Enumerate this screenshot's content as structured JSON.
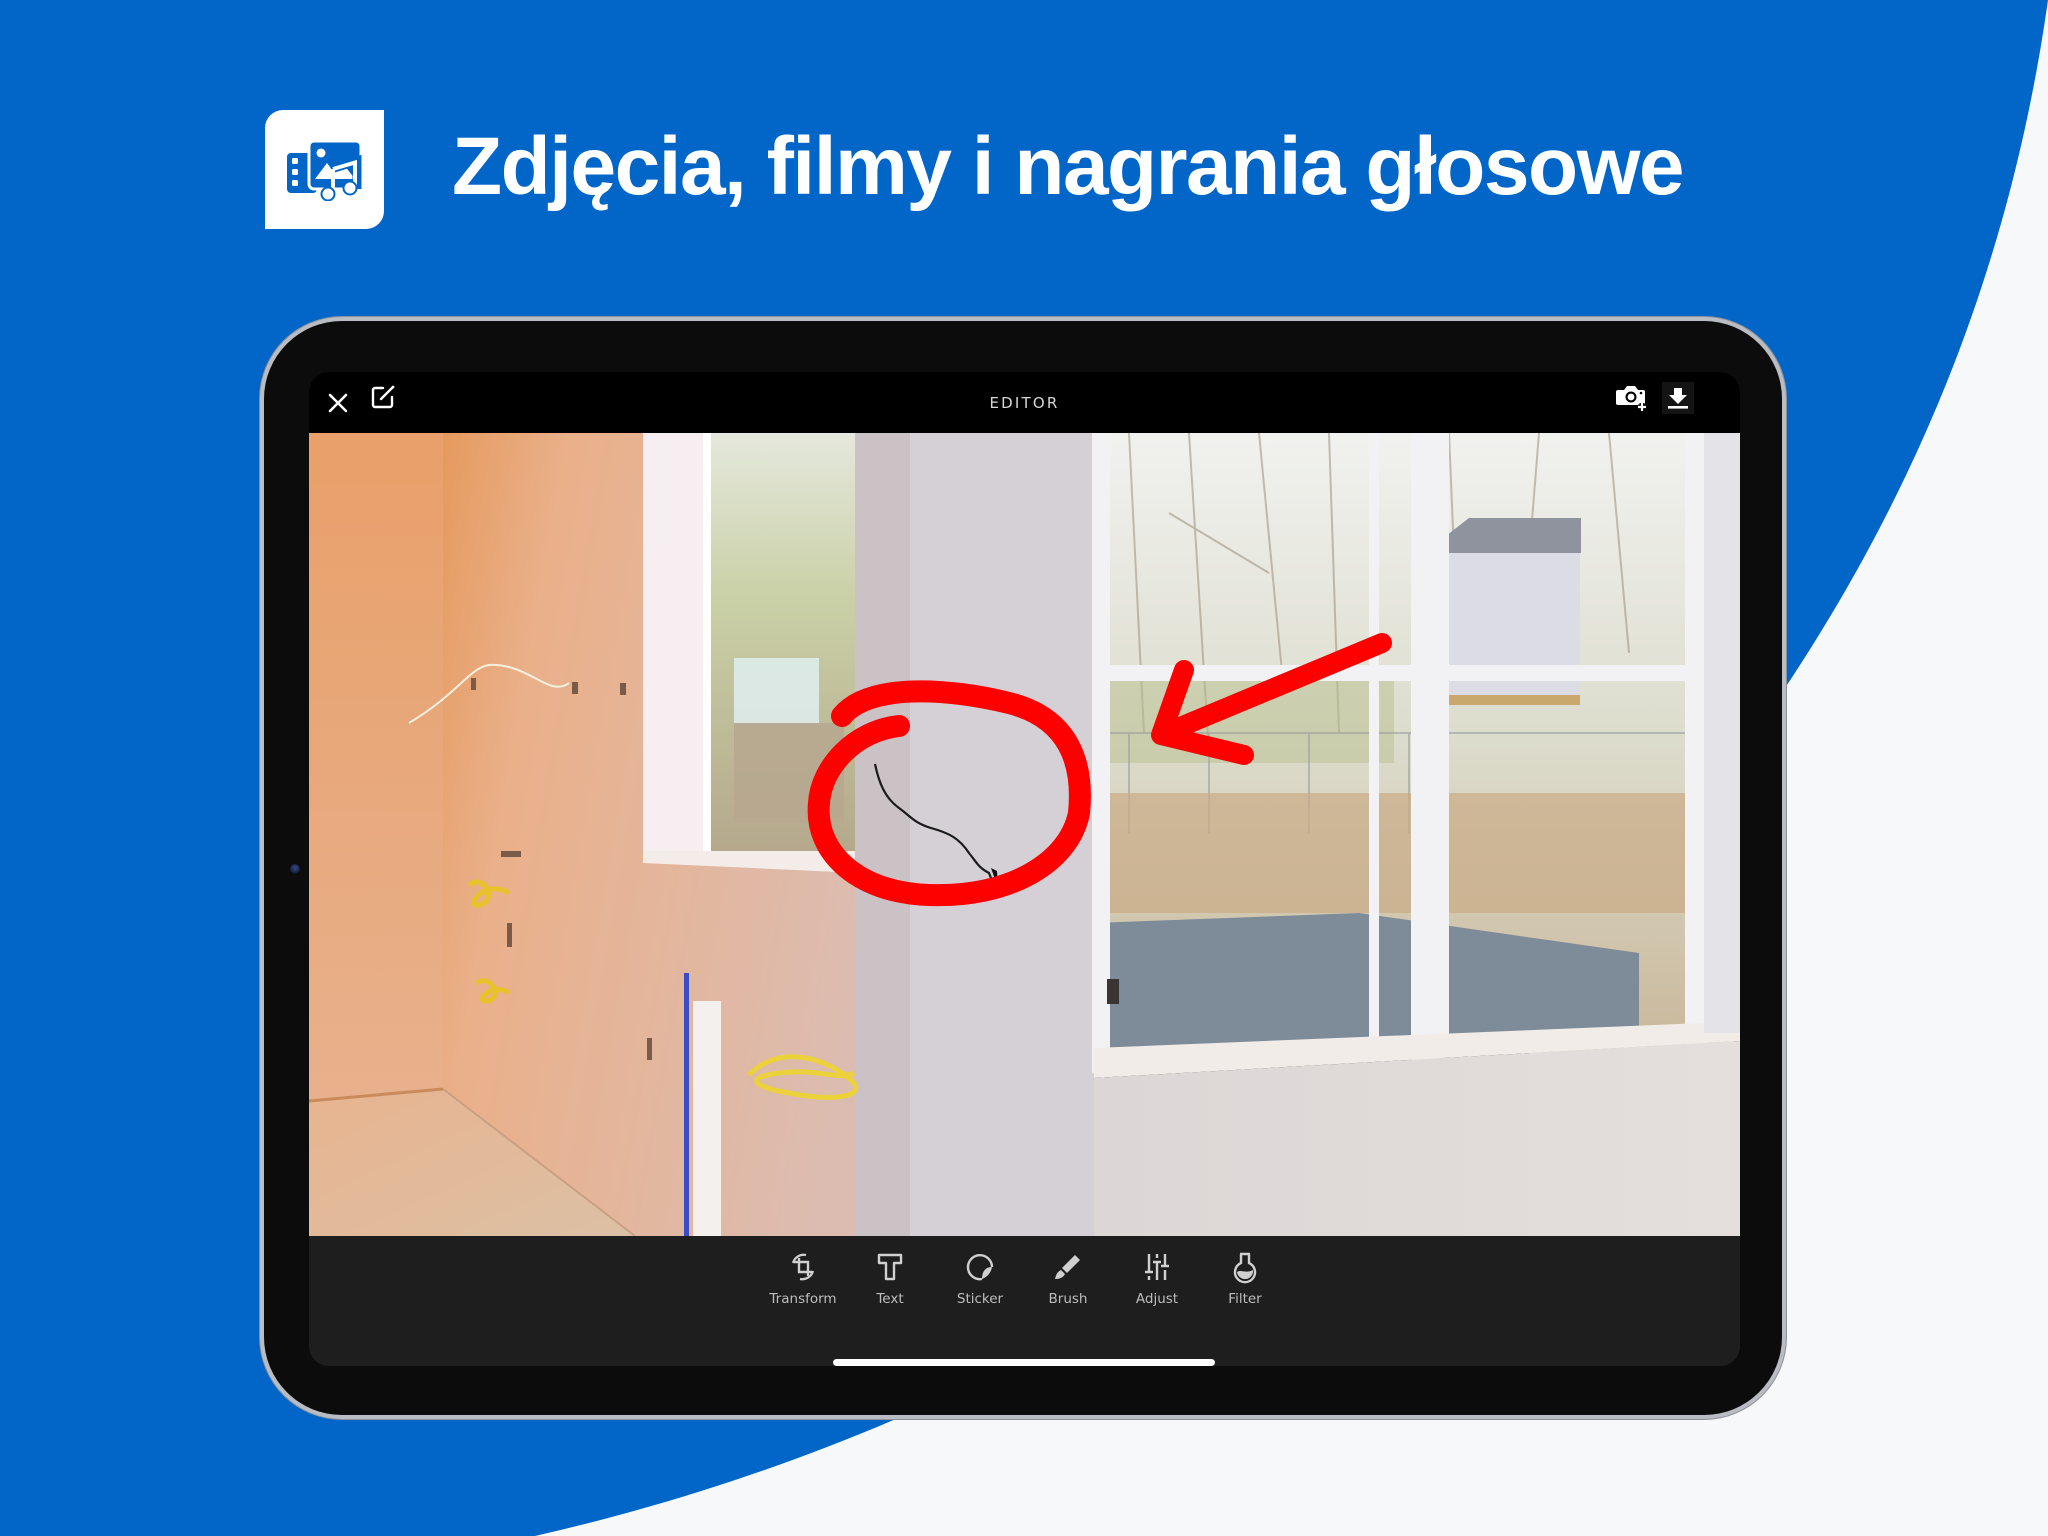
{
  "colors": {
    "brand_blue": "#0265c8",
    "page_background": "#f7f8f9",
    "annotation_red": "#ff0000"
  },
  "header": {
    "badge_icon": "media-gallery-icon",
    "headline": "Zdjęcia, filmy i nagrania głosowe"
  },
  "editor": {
    "title": "EDITOR",
    "top_left_icons": [
      {
        "name": "close-icon",
        "symbol": "✕"
      },
      {
        "name": "edit-square-icon",
        "symbol": "✎"
      }
    ],
    "top_right_icons": [
      {
        "name": "add-photo-camera-icon",
        "symbol": "📷+"
      },
      {
        "name": "download-icon",
        "symbol": "⬇"
      }
    ],
    "photo": {
      "description": "Interior room under renovation with drywall, windows and a marked crack",
      "annotations": [
        "red circle around crack",
        "red arrow pointing at circle"
      ]
    },
    "tools": [
      {
        "label": "Transform",
        "icon": "crop-rotate-icon"
      },
      {
        "label": "Text",
        "icon": "text-icon"
      },
      {
        "label": "Sticker",
        "icon": "sticker-icon"
      },
      {
        "label": "Brush",
        "icon": "brush-icon"
      },
      {
        "label": "Adjust",
        "icon": "sliders-icon"
      },
      {
        "label": "Filter",
        "icon": "flask-icon"
      }
    ]
  }
}
